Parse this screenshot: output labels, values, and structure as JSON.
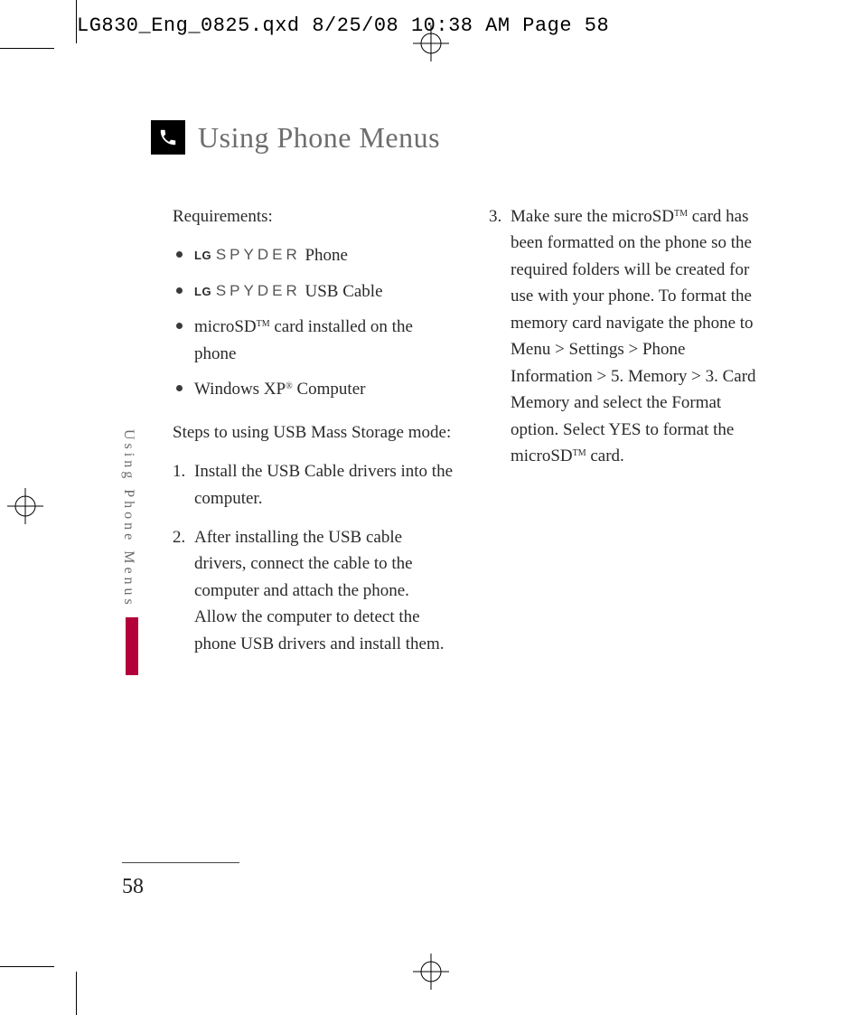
{
  "slug": "LG830_Eng_0825.qxd  8/25/08  10:38 AM  Page 58",
  "title": "Using Phone Menus",
  "side_tab": "Using Phone Menus",
  "page_number": "58",
  "requirements_label": "Requirements:",
  "requirements": [
    {
      "brand_lg": "LG",
      "brand_model": "SPYDER",
      "suffix": " Phone"
    },
    {
      "brand_lg": "LG",
      "brand_model": "SPYDER",
      "suffix": " USB Cable"
    },
    {
      "text_pre": "microSD",
      "sup": "TM",
      "text_post": " card installed on the phone"
    },
    {
      "text_pre": "Windows XP",
      "sup": "®",
      "text_post": " Computer"
    }
  ],
  "steps_label": "Steps to using USB Mass Storage mode:",
  "steps_left": [
    {
      "num": "1.",
      "text": "Install the USB Cable drivers into the computer."
    },
    {
      "num": "2.",
      "text": "After installing the USB cable drivers, connect the cable to the computer and attach the phone. Allow the computer to detect the phone USB drivers and install them."
    }
  ],
  "steps_right": [
    {
      "num": "3.",
      "pre": "Make sure the microSD",
      "sup1": "TM",
      "mid": " card has been formatted on the phone so the required folders will be created for use with your phone. To format the memory card navigate the phone to Menu > Settings > Phone Information > 5. Memory > 3. Card Memory and select the Format option. Select YES to format the microSD",
      "sup2": "TM",
      "post": " card."
    }
  ]
}
